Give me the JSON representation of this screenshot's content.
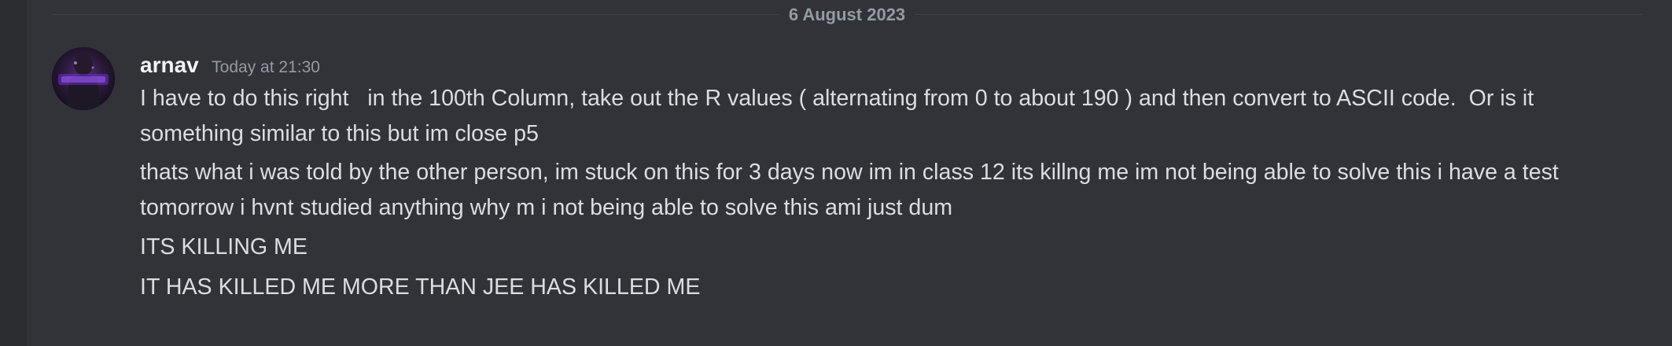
{
  "date_divider": "6 August 2023",
  "message_group": {
    "author": "arnav",
    "timestamp": "Today at 21:30",
    "avatar_icon": "dark-purple-avatar-icon",
    "messages": [
      "I have to do this right   in the 100th Column, take out the R values ( alternating from 0 to about 190 ) and then convert to ASCII code.  Or is it something similar to this but im close p5",
      "thats what i was told by the other person, im stuck on this for 3 days now im in class 12 its killng me im not being able to solve this i have a test tomorrow i hvnt studied anything why m i not being able to solve this ami just dum",
      "ITS KILLING ME",
      "IT HAS KILLED ME MORE THAN JEE HAS KILLED ME"
    ]
  },
  "colors": {
    "background": "#313338",
    "rail": "#2b2d31",
    "text": "#dbdee1",
    "muted": "#949ba4",
    "username": "#f2f3f5"
  }
}
